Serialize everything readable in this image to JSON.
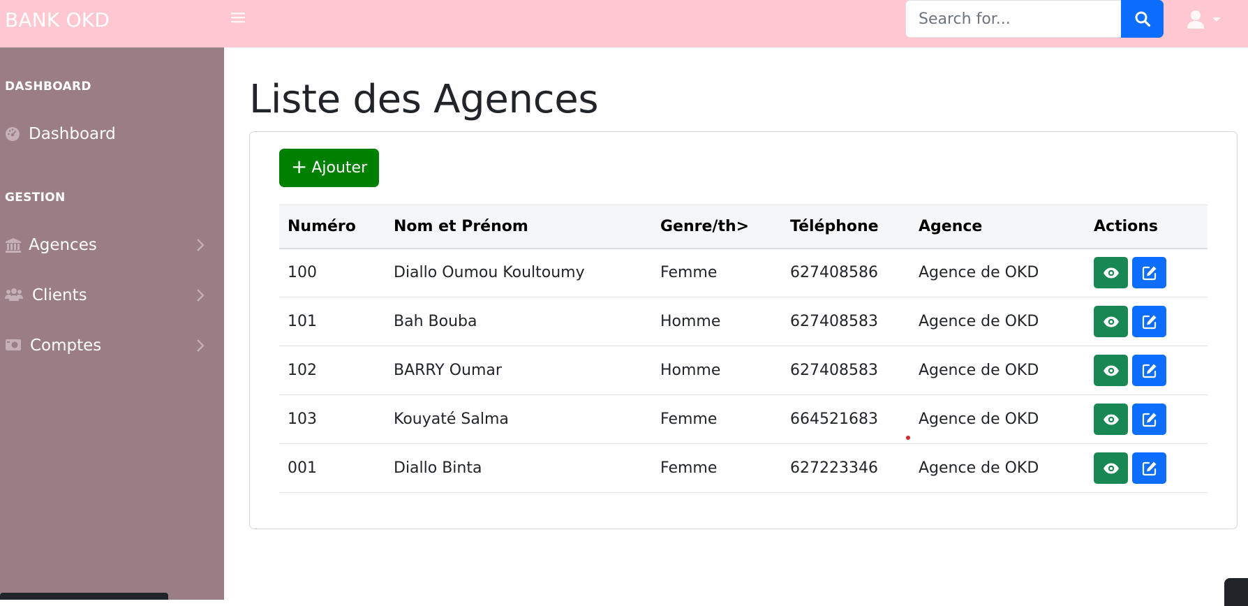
{
  "app": {
    "brand": "BANK OKD"
  },
  "search": {
    "placeholder": "Search for..."
  },
  "sidebar": {
    "headings": [
      "DASHBOARD",
      "GESTION"
    ],
    "items": [
      {
        "label": "Dashboard",
        "icon": "tachometer-icon"
      },
      {
        "label": "Agences",
        "icon": "bank-icon"
      },
      {
        "label": "Clients",
        "icon": "users-icon"
      },
      {
        "label": "Comptes",
        "icon": "money-bill-icon"
      }
    ]
  },
  "main": {
    "title": "Liste des Agences",
    "add_label": "Ajouter",
    "table": {
      "headers": [
        "Numéro",
        "Nom et Prénom",
        "Genre/th>",
        "Téléphone",
        "Agence",
        "Actions"
      ],
      "rows": [
        {
          "numero": "100",
          "nom": "Diallo Oumou Koultoumy",
          "genre": "Femme",
          "telephone": "627408586",
          "agence": "Agence de OKD"
        },
        {
          "numero": "101",
          "nom": "Bah Bouba",
          "genre": "Homme",
          "telephone": "627408583",
          "agence": "Agence de OKD"
        },
        {
          "numero": "102",
          "nom": "BARRY Oumar",
          "genre": "Homme",
          "telephone": "627408583",
          "agence": "Agence de OKD"
        },
        {
          "numero": "103",
          "nom": "Kouyaté Salma",
          "genre": "Femme",
          "telephone": "664521683",
          "agence": "Agence de OKD"
        },
        {
          "numero": "001",
          "nom": "Diallo Binta",
          "genre": "Femme",
          "telephone": "627223346",
          "agence": "Agence de OKD"
        }
      ]
    }
  },
  "colors": {
    "topbar": "#ffc8d0",
    "sidebar": "#9b7d85",
    "primary": "#0d6efd",
    "success": "#198754",
    "add_button": "#008000"
  }
}
